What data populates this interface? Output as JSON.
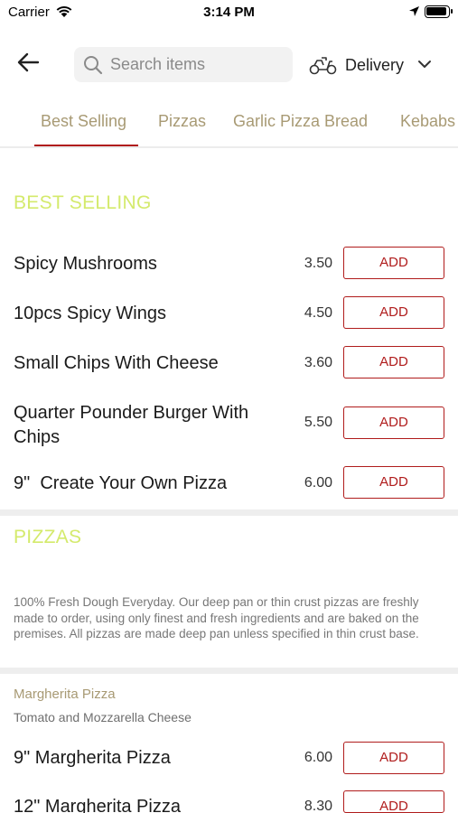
{
  "status_bar": {
    "carrier": "Carrier",
    "time": "3:14 PM"
  },
  "header": {
    "search_placeholder": "Search items",
    "delivery_label": "Delivery",
    "icons": {
      "back": "arrow-left-icon",
      "search": "search-icon",
      "delivery": "scooter-icon",
      "dropdown": "chevron-down-icon"
    }
  },
  "tabs": [
    {
      "label": "Best Selling",
      "active": true
    },
    {
      "label": "Pizzas",
      "active": false
    },
    {
      "label": "Garlic Pizza Bread",
      "active": false
    },
    {
      "label": "Kebabs",
      "active": false
    }
  ],
  "colors": {
    "accent": "#b01c1c",
    "section_title": "#d4ea6c",
    "tab_text": "#a89a74"
  },
  "best_selling": {
    "title": "BEST SELLING",
    "items": [
      {
        "name": "Spicy Mushrooms",
        "price": "3.50",
        "button": "ADD"
      },
      {
        "name": "10pcs Spicy Wings",
        "price": "4.50",
        "button": "ADD"
      },
      {
        "name": "Small Chips With Cheese",
        "price": "3.60",
        "button": "ADD"
      },
      {
        "name": "Quarter Pounder Burger With Chips",
        "price": "5.50",
        "button": "ADD"
      },
      {
        "name": "9\"  Create Your Own Pizza",
        "price": "6.00",
        "button": "ADD"
      }
    ]
  },
  "pizzas": {
    "title": "PIZZAS",
    "description": "100% Fresh Dough Everyday. Our deep pan or thin crust pizzas are freshly made to order, using only finest and fresh ingredients and are baked on the premises. All pizzas are made deep pan unless specified in thin crust base.",
    "subcategory": {
      "title": "Margherita Pizza",
      "description": "Tomato and Mozzarella Cheese",
      "items": [
        {
          "name": "9\" Margherita Pizza",
          "price": "6.00",
          "button": "ADD"
        },
        {
          "name": "12\" Margherita Pizza",
          "price": "8.30",
          "button": "ADD"
        }
      ]
    }
  }
}
